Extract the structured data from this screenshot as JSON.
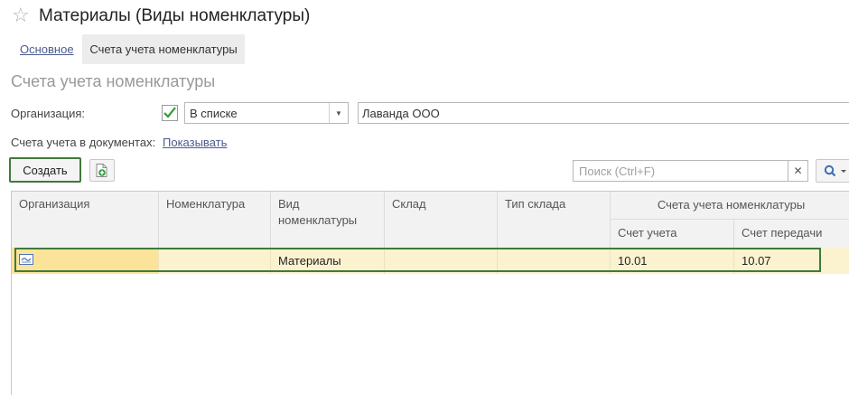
{
  "window": {
    "title": "Материалы (Виды номенклатуры)"
  },
  "tabs": {
    "main": "Основное",
    "active": "Счета учета номенклатуры"
  },
  "section": {
    "title": "Счета учета номенклатуры"
  },
  "filter": {
    "org_label": "Организация:",
    "mode_value": "В списке",
    "org_value": "Лаванда ООО",
    "doc_accounts_label": "Счета учета в документах:",
    "doc_accounts_link": "Показывать"
  },
  "toolbar": {
    "create_label": "Создать",
    "search_placeholder": "Поиск (Ctrl+F)",
    "search_value": ""
  },
  "table": {
    "headers": {
      "org": "Организация",
      "nomenclature": "Номенклатура",
      "kind": "Вид номенклатуры",
      "warehouse": "Склад",
      "warehouse_type": "Тип склада",
      "accounts_group": "Счета учета номенклатуры",
      "account": "Счет учета",
      "transfer_account": "Счет передачи"
    },
    "rows": [
      {
        "org": "",
        "nomenclature": "",
        "kind": "Материалы",
        "warehouse": "",
        "warehouse_type": "",
        "account": "10.01",
        "transfer_account": "10.07"
      }
    ]
  },
  "icons": {
    "favorite": "star-icon",
    "checked": "checkmark-icon",
    "dropdown": "chevron-down-icon",
    "copy": "copy-document-icon",
    "clear": "close-icon",
    "search": "magnifier-icon",
    "row_marker": "record-icon"
  },
  "colors": {
    "link": "#4a5b8c",
    "highlight_border": "#3f7a3a",
    "selected_row": "#fbf3cf",
    "selected_cell": "#fbe49a",
    "checkmark": "#2e9a3a"
  }
}
